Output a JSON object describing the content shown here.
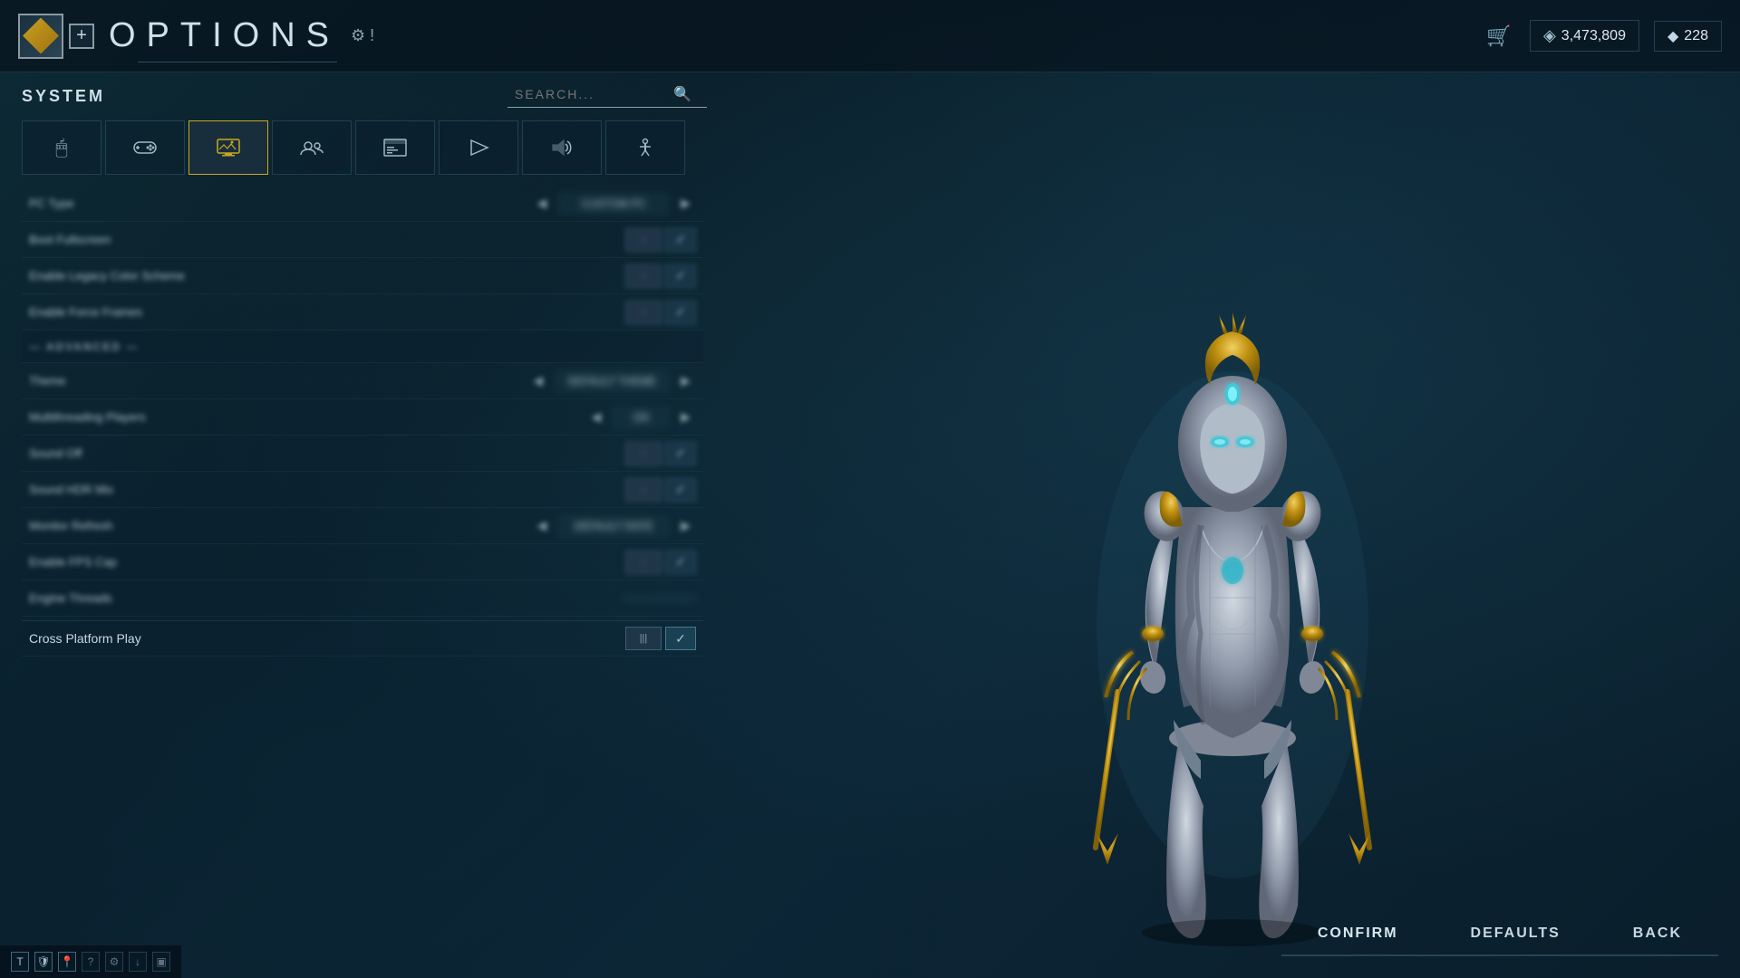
{
  "header": {
    "title": "OPTIONS",
    "add_btn": "+",
    "search_placeholder": "SEARCH...",
    "currency_credits": "3,473,809",
    "currency_platinum": "228"
  },
  "tabs": [
    {
      "id": "mouse",
      "icon": "🖱",
      "label": "Mouse"
    },
    {
      "id": "controller",
      "icon": "🎮",
      "label": "Controller"
    },
    {
      "id": "display",
      "icon": "⚙",
      "label": "Display",
      "active": true
    },
    {
      "id": "social",
      "icon": "👥",
      "label": "Social"
    },
    {
      "id": "interface",
      "icon": "🖥",
      "label": "Interface"
    },
    {
      "id": "gameplay",
      "icon": "▶",
      "label": "Gameplay"
    },
    {
      "id": "audio",
      "icon": "🔊",
      "label": "Audio"
    },
    {
      "id": "accessibility",
      "icon": "♿",
      "label": "Accessibility"
    }
  ],
  "section_label": "SYSTEM",
  "settings": [
    {
      "id": "pc-type",
      "label": "PC Type",
      "type": "select",
      "value": "CUSTOM PC",
      "blurred": true
    },
    {
      "id": "setting2",
      "label": "Boot Fullscreen",
      "type": "toggle",
      "blurred": true
    },
    {
      "id": "setting3",
      "label": "Enable Legacy Color Scheme",
      "type": "toggle",
      "blurred": true
    },
    {
      "id": "setting4",
      "label": "Enable Force Frames",
      "type": "toggle",
      "blurred": true
    },
    {
      "id": "section1",
      "label": "— ADVANCED —",
      "type": "section",
      "blurred": true
    },
    {
      "id": "theme",
      "label": "Theme",
      "type": "select",
      "value": "DEFAULT THEME",
      "blurred": true
    },
    {
      "id": "multithreading",
      "label": "Multithreading Players",
      "type": "select",
      "value": "ON",
      "blurred": true
    },
    {
      "id": "sound-off",
      "label": "Sound Off",
      "type": "toggle",
      "blurred": true
    },
    {
      "id": "sound-hdr",
      "label": "Sound HDR Mix",
      "type": "toggle",
      "blurred": true
    },
    {
      "id": "setting9",
      "label": "Monitor Refresh",
      "type": "select",
      "value": "DEFAULT RATE",
      "blurred": true
    },
    {
      "id": "setting10",
      "label": "Enable FPS Cap",
      "type": "toggle",
      "blurred": true
    },
    {
      "id": "setting11",
      "label": "Engine Threads",
      "type": "text",
      "blurred": true
    },
    {
      "id": "cross-platform",
      "label": "Cross Platform Play",
      "type": "toggle",
      "blurred": false,
      "enabled": true
    }
  ],
  "buttons": {
    "confirm": "CONFIRM",
    "defaults": "DEFAULTS",
    "back": "BACK"
  },
  "taskbar_icons": [
    "T",
    "🛡",
    "📍",
    "?",
    "⚙",
    "📥",
    "▣"
  ],
  "currency_icons": {
    "credits": "◈",
    "platinum": "◆"
  }
}
